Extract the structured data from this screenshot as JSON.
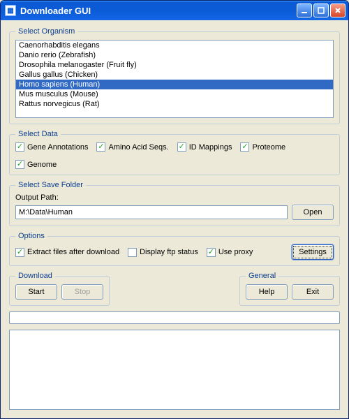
{
  "window": {
    "title": "Downloader GUI"
  },
  "organism": {
    "legend": "Select Organism",
    "items": [
      "Caenorhabditis elegans",
      "Danio rerio (Zebrafish)",
      "Drosophila melanogaster (Fruit fly)",
      "Gallus gallus (Chicken)",
      "Homo sapiens (Human)",
      "Mus musculus (Mouse)",
      "Rattus norvegicus (Rat)"
    ],
    "selected_index": 4
  },
  "data": {
    "legend": "Select Data",
    "checks": [
      {
        "label": "Gene Annotations",
        "checked": true
      },
      {
        "label": "Amino Acid Seqs.",
        "checked": true
      },
      {
        "label": "ID Mappings",
        "checked": true
      },
      {
        "label": "Proteome",
        "checked": true
      },
      {
        "label": "Genome",
        "checked": true
      }
    ]
  },
  "save": {
    "legend": "Select Save Folder",
    "path_label": "Output Path:",
    "path_value": "M:\\Data\\Human",
    "open_label": "Open"
  },
  "options": {
    "legend": "Options",
    "extract": {
      "label": "Extract files after download",
      "checked": true
    },
    "ftp": {
      "label": "Display ftp status",
      "checked": false
    },
    "proxy": {
      "label": "Use proxy",
      "checked": true
    },
    "settings_label": "Settings"
  },
  "download": {
    "legend": "Download",
    "start_label": "Start",
    "stop_label": "Stop"
  },
  "general": {
    "legend": "General",
    "help_label": "Help",
    "exit_label": "Exit"
  }
}
